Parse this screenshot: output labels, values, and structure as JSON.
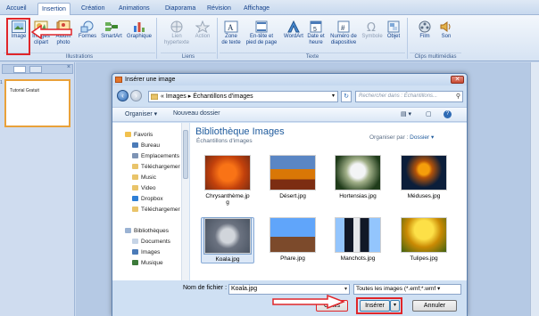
{
  "ribbon": {
    "tabs": [
      "Accueil",
      "Insertion",
      "Création",
      "Animations",
      "Diaporama",
      "Révision",
      "Affichage"
    ],
    "active_tab": "Insertion",
    "buttons": {
      "image": "Image",
      "images_clipart": [
        "Images",
        "clipart"
      ],
      "album_photo": [
        "Album",
        "photo"
      ],
      "formes": "Formes",
      "smartart": "SmartArt",
      "graphique": "Graphique",
      "lien_hypertexte": [
        "Lien",
        "hypertexte"
      ],
      "action": "Action",
      "zone_texte": [
        "Zone",
        "de texte"
      ],
      "entete": [
        "En-tête et",
        "pied de page"
      ],
      "wordart": "WordArt",
      "date_heure": [
        "Date et",
        "heure"
      ],
      "numero_diapo": [
        "Numéro de",
        "diapositive"
      ],
      "symbole": "Symbole",
      "objet": "Objet",
      "film": "Film",
      "son": "Son"
    },
    "groups": {
      "illustrations": "Illustrations",
      "liens": "Liens",
      "texte": "Texte",
      "clips": "Clips multimédias"
    }
  },
  "slide_panel": {
    "slide_number": "1",
    "slide_text": "Tutorial Gratuit"
  },
  "dialog": {
    "title": "Insérer une image",
    "close_glyph": "✕",
    "address": "« Images ▸ Échantillons d'images",
    "search_placeholder": "Rechercher dans : Échantillons...",
    "command_bar": {
      "organize": "Organiser ▾",
      "new_folder": "Nouveau dossier"
    },
    "nav_items": [
      {
        "label": "Favoris",
        "kind": "favorites"
      },
      {
        "label": "Bureau",
        "kind": "desktop"
      },
      {
        "label": "Emplacements",
        "kind": "places"
      },
      {
        "label": "Téléchargemer",
        "kind": "folder"
      },
      {
        "label": "Music",
        "kind": "folder"
      },
      {
        "label": "Video",
        "kind": "folder"
      },
      {
        "label": "Dropbox",
        "kind": "dropbox"
      },
      {
        "label": "Téléchargemer",
        "kind": "folder"
      },
      {
        "label": "Bibliothèques",
        "kind": "library"
      },
      {
        "label": "Documents",
        "kind": "doc"
      },
      {
        "label": "Images",
        "kind": "images"
      },
      {
        "label": "Musique",
        "kind": "music"
      }
    ],
    "library": {
      "title": "Bibliothèque Images",
      "subtitle": "Échantillons d'images",
      "organize_label": "Organiser par :",
      "organize_value": "Dossier ▾"
    },
    "thumbnails": [
      {
        "name": "Chrysanthème.jp\ng",
        "colors": [
          "#c2410c",
          "#f97316"
        ]
      },
      {
        "name": "Désert.jpg",
        "colors": [
          "#7c2d12",
          "#d97706"
        ]
      },
      {
        "name": "Hortensias.jpg",
        "colors": [
          "#1f3b1a",
          "#e5e7eb"
        ]
      },
      {
        "name": "Méduses.jpg",
        "colors": [
          "#0b1e3a",
          "#f59e0b"
        ]
      },
      {
        "name": "Koala.jpg",
        "colors": [
          "#4b5563",
          "#d1d5db"
        ]
      },
      {
        "name": "Phare.jpg",
        "colors": [
          "#60a5fa",
          "#7c4a2b"
        ]
      },
      {
        "name": "Manchots.jpg",
        "colors": [
          "#93c5fd",
          "#111827"
        ]
      },
      {
        "name": "Tulipes.jpg",
        "colors": [
          "#fde047",
          "#ca8a04"
        ]
      }
    ],
    "filename_label": "Nom de fichier :",
    "filename_value": "Koala.jpg",
    "filter_value": "Toutes les images (*.emf;*.wmf ▾",
    "tools_label": "Outils",
    "insert_label": "Insérer",
    "cancel_label": "Annuler"
  },
  "colors": {
    "highlight_red": "#e0262a",
    "accent_blue": "#1e5a9c"
  }
}
